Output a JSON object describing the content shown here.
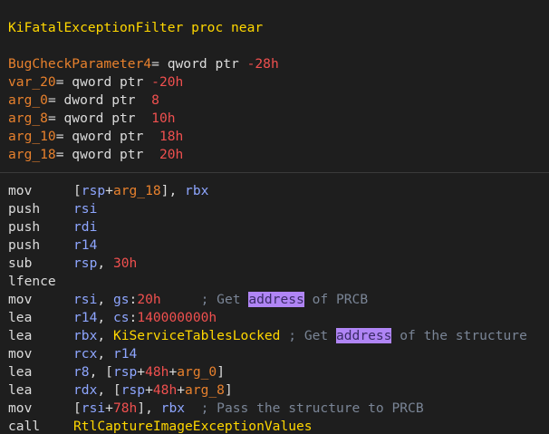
{
  "proc_header": "KiFatalExceptionFilter proc near",
  "vars": [
    {
      "name": "BugCheckParameter4",
      "eq": "= ",
      "type": "qword ptr ",
      "offset": "-28h"
    },
    {
      "name": "var_20",
      "eq": "= ",
      "type": "qword ptr ",
      "offset": "-20h"
    },
    {
      "name": "arg_0",
      "eq": "= ",
      "type": "dword ptr  ",
      "offset": "8"
    },
    {
      "name": "arg_8",
      "eq": "= ",
      "type": "qword ptr  ",
      "offset": "10h"
    },
    {
      "name": "arg_10",
      "eq": "= ",
      "type": "qword ptr  ",
      "offset": "18h"
    },
    {
      "name": "arg_18",
      "eq": "= ",
      "type": "qword ptr  ",
      "offset": "20h"
    }
  ],
  "code": [
    {
      "mnem": "mov",
      "ops": [
        [
          "t",
          "["
        ],
        [
          "r",
          "rsp"
        ],
        [
          "t",
          "+"
        ],
        [
          "v",
          "arg_18"
        ],
        [
          "t",
          "], "
        ],
        [
          "r",
          "rbx"
        ]
      ]
    },
    {
      "mnem": "push",
      "ops": [
        [
          "r",
          "rsi"
        ]
      ]
    },
    {
      "mnem": "push",
      "ops": [
        [
          "r",
          "rdi"
        ]
      ]
    },
    {
      "mnem": "push",
      "ops": [
        [
          "r",
          "r14"
        ]
      ]
    },
    {
      "mnem": "sub",
      "ops": [
        [
          "r",
          "rsp"
        ],
        [
          "t",
          ", "
        ],
        [
          "n",
          "30h"
        ]
      ]
    },
    {
      "mnem": "lfence",
      "ops": []
    },
    {
      "mnem": "mov",
      "ops": [
        [
          "r",
          "rsi"
        ],
        [
          "t",
          ", "
        ],
        [
          "r",
          "gs"
        ],
        [
          "t",
          ":"
        ],
        [
          "n",
          "20h"
        ],
        [
          "t",
          "     "
        ],
        [
          "c",
          "; Get "
        ],
        [
          "h",
          "address"
        ],
        [
          "c",
          " of PRCB"
        ]
      ]
    },
    {
      "mnem": "lea",
      "ops": [
        [
          "r",
          "r14"
        ],
        [
          "t",
          ", "
        ],
        [
          "r",
          "cs"
        ],
        [
          "t",
          ":"
        ],
        [
          "n",
          "140000000h"
        ]
      ]
    },
    {
      "mnem": "lea",
      "ops": [
        [
          "r",
          "rbx"
        ],
        [
          "t",
          ", "
        ],
        [
          "s",
          "KiServiceTablesLocked"
        ],
        [
          "t",
          " "
        ],
        [
          "c",
          "; Get "
        ],
        [
          "h",
          "address"
        ],
        [
          "c",
          " of the structure"
        ]
      ]
    },
    {
      "mnem": "mov",
      "ops": [
        [
          "r",
          "rcx"
        ],
        [
          "t",
          ", "
        ],
        [
          "r",
          "r14"
        ]
      ]
    },
    {
      "mnem": "lea",
      "ops": [
        [
          "r",
          "r8"
        ],
        [
          "t",
          ", ["
        ],
        [
          "r",
          "rsp"
        ],
        [
          "t",
          "+"
        ],
        [
          "n",
          "48h"
        ],
        [
          "t",
          "+"
        ],
        [
          "v",
          "arg_0"
        ],
        [
          "t",
          "]"
        ]
      ]
    },
    {
      "mnem": "lea",
      "ops": [
        [
          "r",
          "rdx"
        ],
        [
          "t",
          ", ["
        ],
        [
          "r",
          "rsp"
        ],
        [
          "t",
          "+"
        ],
        [
          "n",
          "48h"
        ],
        [
          "t",
          "+"
        ],
        [
          "v",
          "arg_8"
        ],
        [
          "t",
          "]"
        ]
      ]
    },
    {
      "mnem": "mov",
      "ops": [
        [
          "t",
          "["
        ],
        [
          "r",
          "rsi"
        ],
        [
          "t",
          "+"
        ],
        [
          "n",
          "78h"
        ],
        [
          "t",
          "], "
        ],
        [
          "r",
          "rbx"
        ],
        [
          "t",
          "  "
        ],
        [
          "c",
          "; Pass the structure to PRCB"
        ]
      ]
    },
    {
      "mnem": "call",
      "ops": [
        [
          "s",
          "RtlCaptureImageExceptionValues"
        ]
      ]
    }
  ],
  "colors": {
    "background": "#1e1e1e",
    "proc": "#ffd700",
    "variable": "#e8812d",
    "number": "#f0504f",
    "register": "#8ea6ff",
    "comment": "#7a8596",
    "highlight": "#b085f5"
  }
}
